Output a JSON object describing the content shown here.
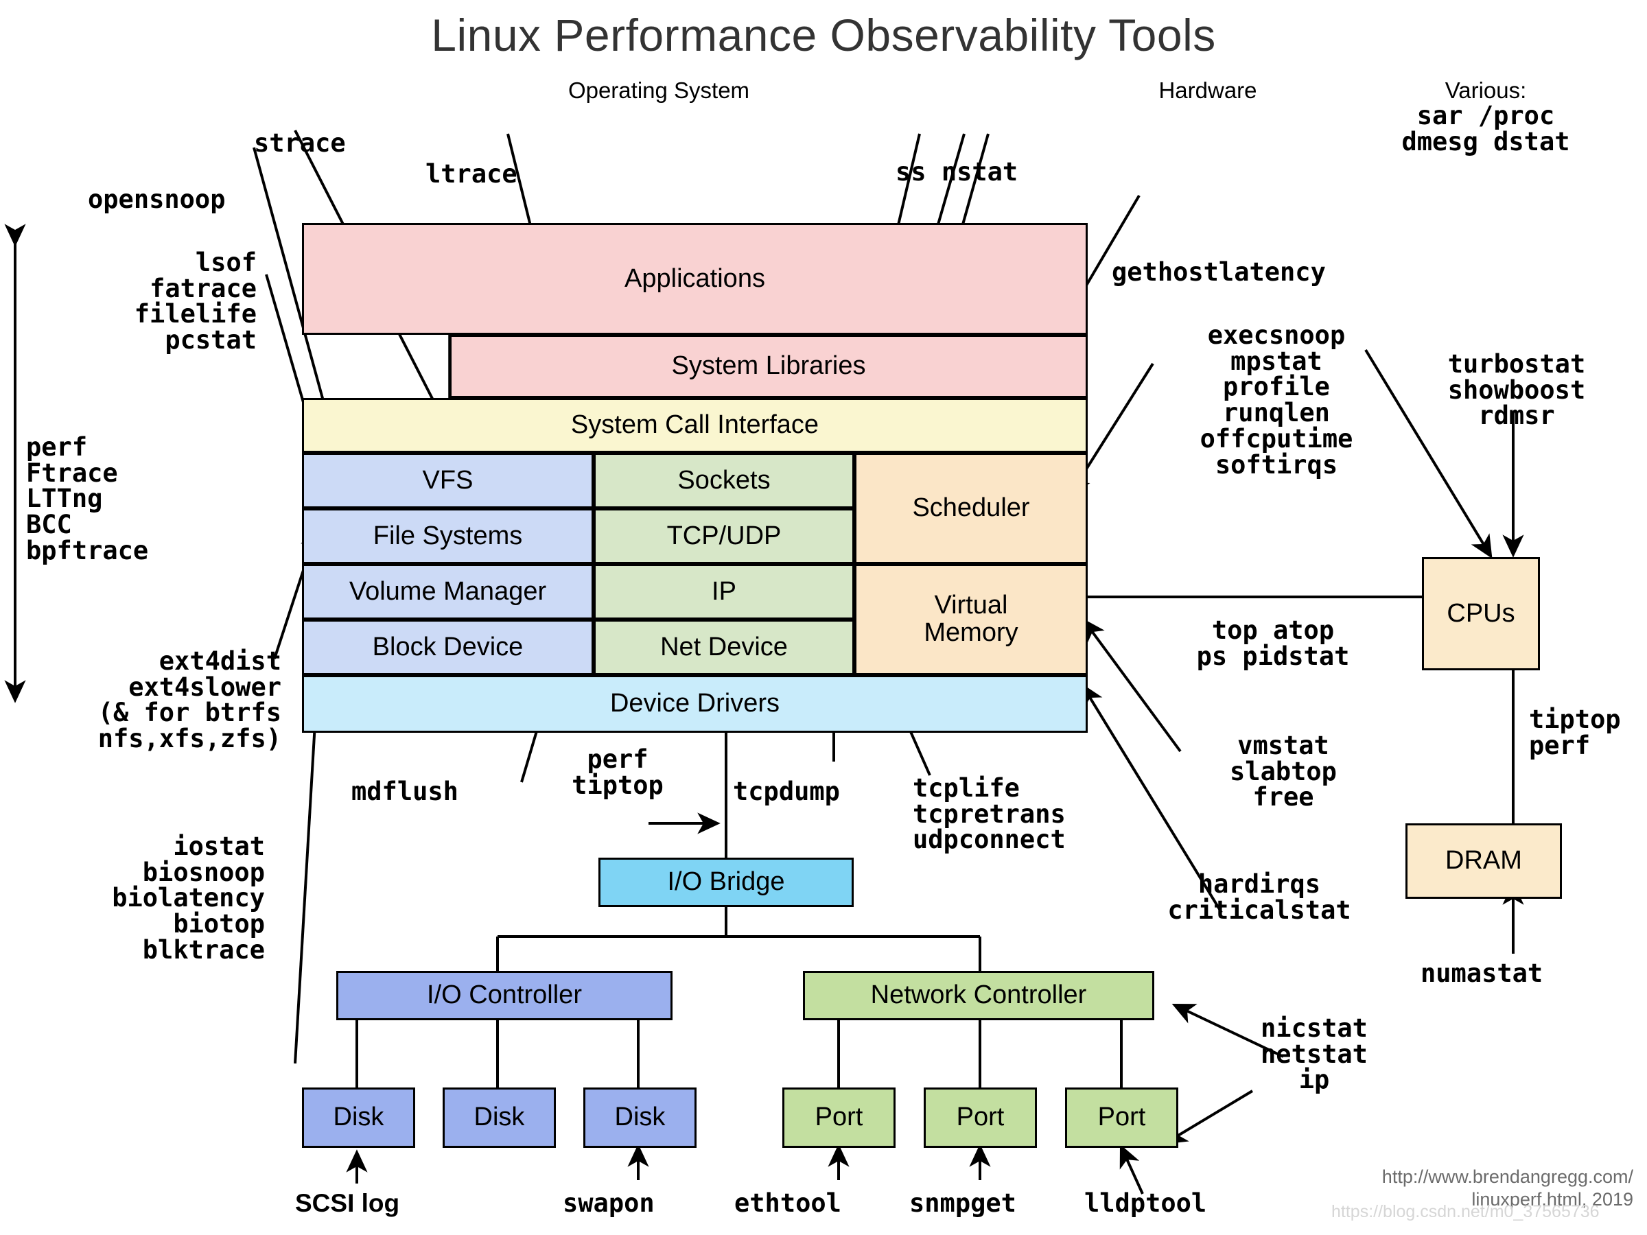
{
  "title": "Linux Performance Observability Tools",
  "headers": {
    "os": "Operating System",
    "hardware": "Hardware",
    "various": "Various:"
  },
  "stack": {
    "applications": "Applications",
    "system_libraries": "System Libraries",
    "system_call_interface": "System Call Interface",
    "vfs": "VFS",
    "sockets": "Sockets",
    "scheduler": "Scheduler",
    "file_systems": "File Systems",
    "tcp_udp": "TCP/UDP",
    "volume_manager": "Volume Manager",
    "ip": "IP",
    "virtual_memory": "Virtual\nMemory",
    "block_device": "Block Device",
    "net_device": "Net Device",
    "device_drivers": "Device Drivers"
  },
  "hardware": {
    "cpus": "CPUs",
    "dram": "DRAM",
    "io_bridge": "I/O Bridge",
    "io_controller": "I/O Controller",
    "network_controller": "Network Controller",
    "disk1": "Disk",
    "disk2": "Disk",
    "disk3": "Disk",
    "port1": "Port",
    "port2": "Port",
    "port3": "Port"
  },
  "tools": {
    "strace": "strace",
    "ltrace": "ltrace",
    "opensnoop": "opensnoop",
    "file_group": "lsof\nfatrace\nfilelife\npcstat",
    "tracers": "perf\nFtrace\nLTTng\nBCC\nbpftrace",
    "ext4_group": "ext4dist\next4slower\n(& for btrfs\nnfs,xfs,zfs)",
    "block_group": "iostat\nbiosnoop\nbiolatency\nbiotop\nblktrace",
    "ss_nstat": "ss nstat",
    "various_cmds": "sar /proc\ndmesg dstat",
    "gethostlatency": "gethostlatency",
    "cpu_group": "execsnoop\nmpstat\nprofile\nrunqlen\noffcputime\nsoftirqs",
    "turbostat_group": "turbostat\nshowboost\nrdmsr",
    "proc_group": "top atop\nps pidstat",
    "tiptop_perf": "tiptop\nperf",
    "mem_group": "vmstat\nslabtop\nfree",
    "irq_group": "hardirqs\ncriticalstat",
    "numastat": "numastat",
    "mdflush": "mdflush",
    "perf_tiptop": "perf\ntiptop",
    "tcpdump": "tcpdump",
    "tcp_group": "tcplife\ntcpretrans\nudpconnect",
    "nic_group": "nicstat\nnetstat\nip",
    "scsi_log": "SCSI log",
    "swapon": "swapon",
    "ethtool": "ethtool",
    "snmpget": "snmpget",
    "lldptool": "lldptool"
  },
  "footer": {
    "line1": "http://www.brendangregg.com/",
    "line2": "linuxperf.html, 2019",
    "watermark": "https://blog.csdn.net/m0_37565736"
  },
  "colors": {
    "applications": "#f9d2d2",
    "syscall": "#faf6d0",
    "filesystem": "#ccdaf6",
    "network": "#d7e7c8",
    "memory": "#fbe6c7",
    "drivers": "#c9ecfb",
    "io_bridge": "#7fd4f4",
    "io_controller": "#9bb0ee",
    "net_controller": "#c3dfa0",
    "cpu": "#fbeacb",
    "title_text": "#333333",
    "footer_text": "#6b6b6b"
  }
}
